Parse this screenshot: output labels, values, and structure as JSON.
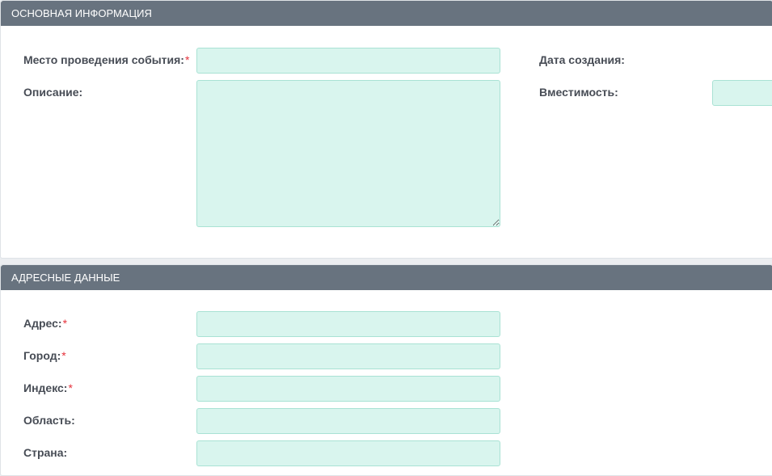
{
  "sections": {
    "main": {
      "title": "Основная информация",
      "venue_label": "Место проведения события:",
      "venue_value": "",
      "description_label": "Описание:",
      "description_value": "",
      "created_label": "Дата создания:",
      "capacity_label": "Вместимость:",
      "capacity_value": ""
    },
    "address": {
      "title": "Адресные данные",
      "address_label": "Адрес:",
      "address_value": "",
      "city_label": "Город:",
      "city_value": "",
      "index_label": "Индекс:",
      "index_value": "",
      "region_label": "Область:",
      "region_value": "",
      "country_label": "Страна:",
      "country_value": ""
    }
  },
  "required_marker": "*",
  "colors": {
    "header_bg": "#68737f",
    "field_bg": "#d9f5ee",
    "field_border": "#a9e2d4",
    "required": "#e5323c"
  }
}
